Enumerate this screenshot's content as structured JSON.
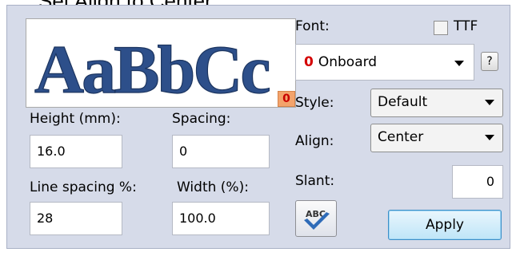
{
  "caption": "Set Align to Center.",
  "preview": {
    "sample_text": "AaBbCc",
    "badge": "0"
  },
  "fields": {
    "height_label": "Height (mm):",
    "height_value": "16.0",
    "spacing_label": "Spacing:",
    "spacing_value": "0",
    "line_spacing_label": "Line spacing %:",
    "line_spacing_value": "28",
    "width_label": "Width (%):",
    "width_value": "100.0"
  },
  "font": {
    "label": "Font:",
    "ttf_label": "TTF",
    "ttf_checked": false,
    "selected_prefix": "0",
    "selected_name": "Onboard",
    "help_label": "?"
  },
  "style": {
    "label": "Style:",
    "value": "Default"
  },
  "align": {
    "label": "Align:",
    "value": "Center"
  },
  "slant": {
    "label": "Slant:",
    "value": "0"
  },
  "spell_button": {
    "icon": "abc-spellcheck-icon",
    "text": "ABC"
  },
  "apply_button": {
    "label": "Apply"
  },
  "colors": {
    "accent": "#3c8fc8",
    "preview_text": "#2d4f8a",
    "badge": "#f3a36b",
    "red": "#d40000"
  }
}
